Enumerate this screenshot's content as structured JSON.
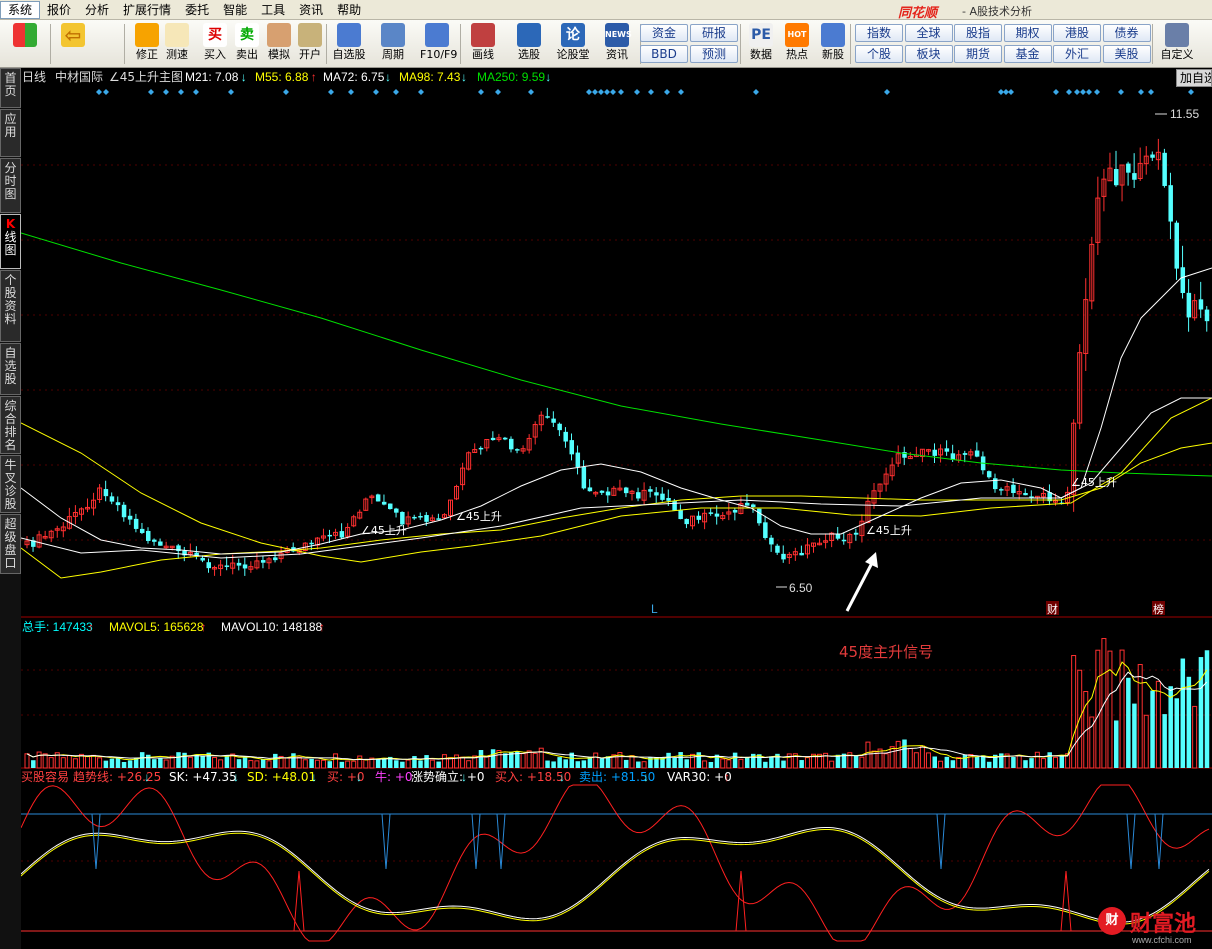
{
  "menu": {
    "items": [
      "系统",
      "报价",
      "分析",
      "扩展行情",
      "委托",
      "智能",
      "工具",
      "资讯",
      "帮助"
    ],
    "brand": "同花顺",
    "app_title": "- A股技术分析"
  },
  "toolbar": {
    "buttons": [
      {
        "label": "",
        "icon": "layout-icon"
      },
      {
        "label": "",
        "icon": "back-arrow-icon"
      },
      {
        "label": "修正",
        "icon": "refresh-icon"
      },
      {
        "label": "测速",
        "icon": "clock-icon"
      },
      {
        "label": "买入",
        "icon": "buy-icon",
        "glyph": "买"
      },
      {
        "label": "卖出",
        "icon": "sell-icon",
        "glyph": "卖"
      },
      {
        "label": "模拟",
        "icon": "hammer-icon"
      },
      {
        "label": "开户",
        "icon": "lock-icon"
      },
      {
        "label": "自选股",
        "icon": "star-icon"
      },
      {
        "label": "周期",
        "icon": "cycle-icon"
      },
      {
        "label": "F10/F9",
        "icon": "f10-icon"
      },
      {
        "label": "画线",
        "icon": "pen-icon"
      },
      {
        "label": "选股",
        "icon": "screen-icon"
      },
      {
        "label": "论股堂",
        "icon": "forum-icon",
        "glyph": "论"
      },
      {
        "label": "资讯",
        "icon": "news-icon",
        "glyph": "NEWS"
      },
      {
        "label": "数据",
        "icon": "pe-icon",
        "glyph": "PE"
      },
      {
        "label": "热点",
        "icon": "hot-icon",
        "glyph": "HOT"
      },
      {
        "label": "新股",
        "icon": "newstock-icon"
      },
      {
        "label": "自定义",
        "icon": "custom-icon"
      }
    ],
    "grid1": [
      "资金",
      "研报",
      "BBD",
      "预测"
    ],
    "grid2": [
      "指数",
      "全球",
      "股指",
      "期权",
      "港股",
      "债券",
      "个股",
      "板块",
      "期货",
      "基金",
      "外汇",
      "美股"
    ]
  },
  "sidebar": {
    "tabs": [
      "首页",
      "应用",
      "分时图",
      "K线图",
      "个股资料",
      "自选股",
      "综合排名",
      "牛叉诊股",
      "超级盘口"
    ],
    "active": "K线图"
  },
  "add_button": "加自选",
  "kline_header": {
    "period": "日线",
    "stock": "中材国际",
    "formula": "∠45上升主图",
    "items": [
      {
        "label": "M21: 7.08",
        "arrow": "↓",
        "color": "#ffffff"
      },
      {
        "label": "M55: 6.88",
        "arrow": "↑",
        "color": "#ffff00"
      },
      {
        "label": "MA72: 6.75",
        "arrow": "↓",
        "color": "#ffffff"
      },
      {
        "label": "MA98: 7.43",
        "arrow": "↓",
        "color": "#ffff00"
      },
      {
        "label": "MA250: 9.59",
        "arrow": "↓",
        "color": "#00e000"
      }
    ]
  },
  "volume_header": {
    "items": [
      {
        "label": "总手: 147433",
        "arrow": "↑",
        "color": "#00ffff"
      },
      {
        "label": "MAVOL5: 165628",
        "arrow": "↑",
        "color": "#ffff00"
      },
      {
        "label": "MAVOL10: 148188",
        "arrow": "↑",
        "color": "#ffffff"
      }
    ]
  },
  "indicator_header": {
    "items": [
      {
        "label": "买股容易",
        "arrow": "",
        "color": "#ff4040"
      },
      {
        "label": "趋势线: +26.25",
        "arrow": "↓",
        "color": "#ff4040"
      },
      {
        "label": "SK: +47.35",
        "arrow": "↓",
        "color": "#ffffff"
      },
      {
        "label": "SD: +48.01",
        "arrow": "↓",
        "color": "#ffff00"
      },
      {
        "label": "买: +0",
        "arrow": "↓",
        "color": "#ff4040"
      },
      {
        "label": "牛: +0",
        "arrow": "",
        "color": "#ff40ff"
      },
      {
        "label": "涨势确立: +0",
        "arrow": "↓",
        "color": "#ffffff"
      },
      {
        "label": "买入: +18.50",
        "arrow": "↓",
        "color": "#ff4040"
      },
      {
        "label": "卖出: +81.50",
        "arrow": "↓",
        "color": "#00a0ff"
      },
      {
        "label": "VAR30: +0",
        "arrow": "↑",
        "color": "#ffffff"
      }
    ]
  },
  "annotations": {
    "high": "11.55",
    "low": "6.50",
    "signal_label": "∠45上升",
    "caption": "45度主升信号",
    "marker_L": "L",
    "marker_cai": "财",
    "marker_bang": "榜"
  },
  "watermark": {
    "name": "财富池",
    "url": "www.cfchi.com"
  },
  "colors": {
    "up": "#ff3030",
    "down": "#54ffff",
    "ma250": "#00e000",
    "ma_yellow": "#ffff00",
    "bg": "#000000"
  }
}
